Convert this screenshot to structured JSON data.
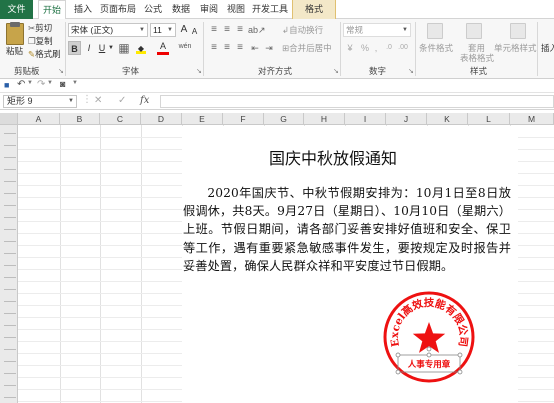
{
  "ribbon_tabs": [
    "文件",
    "开始",
    "插入",
    "页面布局",
    "公式",
    "数据",
    "审阅",
    "视图",
    "开发工具",
    "格式"
  ],
  "clipboard": {
    "paste": "粘贴",
    "cut": "剪切",
    "copy": "复制",
    "format_painter": "格式刷",
    "group_label": "剪贴板"
  },
  "font": {
    "name": "宋体 (正文)",
    "size": "11",
    "bold": "B",
    "italic": "I",
    "underline": "U",
    "grow": "A",
    "shrink": "A",
    "color_letter": "A",
    "wen": "wén",
    "group_label": "字体"
  },
  "alignment": {
    "wrap": "自动换行",
    "merge": "合并后居中",
    "group_label": "对齐方式"
  },
  "number": {
    "format": "常规",
    "percent": "%",
    "comma": ",",
    "group_label": "数字"
  },
  "styles": {
    "conditional": "条件格式",
    "table_line1": "套用",
    "table_line2": "表格格式",
    "cell_styles": "单元格样式",
    "group_label": "样式"
  },
  "cells": {
    "insert": "插入"
  },
  "formula_bar": {
    "name_box": "矩形 9",
    "fx": "fx",
    "cancel": "✕",
    "confirm": "✓",
    "value": ""
  },
  "columns": [
    "A",
    "B",
    "C",
    "D",
    "E",
    "F",
    "G",
    "H",
    "I",
    "J",
    "K",
    "L",
    "M"
  ],
  "document": {
    "title": "国庆中秋放假通知",
    "body": "2020年国庆节、中秋节假期安排为：10月1日至8日放假调休，共8天。9月27日（星期日）、10月10日（星期六）上班。节假日期间，请各部门妥善安排好值班和安全、保卫等工作，遇有重要紧急敏感事件发生，要按规定及时报告并妥善处置，确保人民群众祥和平安度过节日假期。"
  },
  "seal": {
    "ring_text": "Excel高效技能有限公司",
    "bottom_text": "人事专用章",
    "color": "#e11"
  },
  "colors": {
    "accent": "#217346",
    "tab_contextual": "#f3e8c8"
  }
}
